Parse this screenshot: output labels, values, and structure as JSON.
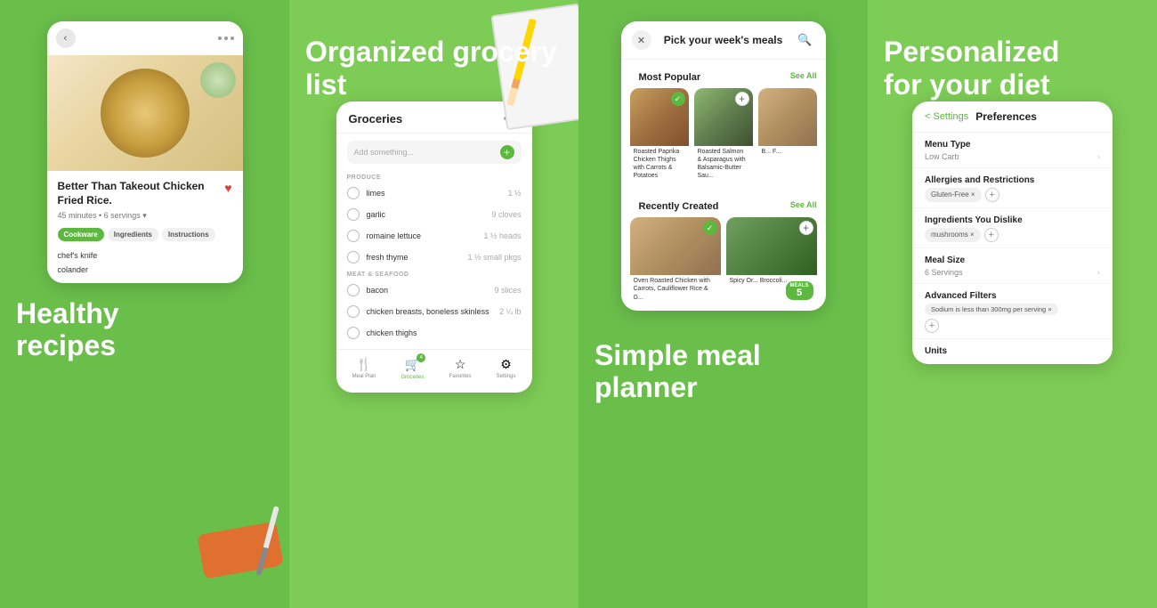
{
  "panel1": {
    "heading1": "Healthy",
    "heading2": "recipes",
    "recipe": {
      "title": "Better Than Takeout Chicken Fried Rice.",
      "meta": "45 minutes • 6 servings ▾",
      "tabs": [
        "Cookware",
        "Ingredients",
        "Instructions"
      ],
      "active_tab": "Cookware",
      "cookware": [
        "chef's knife",
        "colander"
      ]
    }
  },
  "panel2": {
    "heading": "Organized grocery list",
    "groceries_title": "Groceries",
    "add_placeholder": "Add something...",
    "sections": [
      {
        "label": "PRODUCE",
        "items": [
          {
            "name": "limes",
            "qty": "1 ½"
          },
          {
            "name": "garlic",
            "qty": "9 cloves"
          },
          {
            "name": "romaine lettuce",
            "qty": "1 ½ heads"
          },
          {
            "name": "fresh thyme",
            "qty": "1 ½ small pkgs"
          }
        ]
      },
      {
        "label": "MEAT & SEAFOOD",
        "items": [
          {
            "name": "bacon",
            "qty": "9 slices"
          },
          {
            "name": "chicken breasts, boneless skinless",
            "qty": "2 ¼ lb"
          },
          {
            "name": "chicken thighs",
            "qty": ""
          }
        ]
      }
    ],
    "nav": [
      {
        "label": "Meal Plan",
        "icon": "🍴",
        "active": false,
        "badge": ""
      },
      {
        "label": "Groceries",
        "icon": "🛒",
        "active": true,
        "badge": "4"
      },
      {
        "label": "Favorites",
        "icon": "⭐",
        "active": false,
        "badge": ""
      },
      {
        "label": "Settings",
        "icon": "⚙️",
        "active": false,
        "badge": ""
      }
    ]
  },
  "panel3": {
    "heading1": "Simple meal",
    "heading2": "planner",
    "header_title": "Pick your week's meals",
    "most_popular_label": "Most Popular",
    "see_all_1": "See All",
    "recently_created_label": "Recently Created",
    "see_all_2": "See All",
    "meals": [
      {
        "title": "Roasted Paprika Chicken Thighs with Carrots & Potatoes",
        "checked": true
      },
      {
        "title": "Roasted Salmon & Asparagus with Balsamic-Butter Sau...",
        "checked": false
      },
      {
        "title": "B... F...",
        "checked": false
      }
    ],
    "recent_meals": [
      {
        "title": "Oven Roasted Chicken with Carrots, Cauliflower Rice & G...",
        "checked": true
      },
      {
        "title": "Spicy Or... Broccoli...",
        "meals_count": "5",
        "checked": false
      }
    ]
  },
  "panel4": {
    "heading1": "Personalized",
    "heading2": "for your diet",
    "back_label": "< Settings",
    "pref_title": "Preferences",
    "sections": [
      {
        "title": "Menu Type",
        "value": "Low Carb",
        "has_chevron": true,
        "tags": []
      },
      {
        "title": "Allergies and Restrictions",
        "value": "",
        "has_chevron": false,
        "tags": [
          "Gluten-Free ×"
        ]
      },
      {
        "title": "Ingredients You Dislike",
        "value": "",
        "has_chevron": false,
        "tags": [
          "mushrooms ×"
        ]
      },
      {
        "title": "Meal Size",
        "value": "6 Servings",
        "has_chevron": true,
        "tags": []
      },
      {
        "title": "Advanced Filters",
        "value": "",
        "has_chevron": false,
        "tags": [
          "Sodium is less than 300mg per serving ×"
        ]
      },
      {
        "title": "Units",
        "value": "",
        "has_chevron": false,
        "tags": []
      }
    ]
  }
}
